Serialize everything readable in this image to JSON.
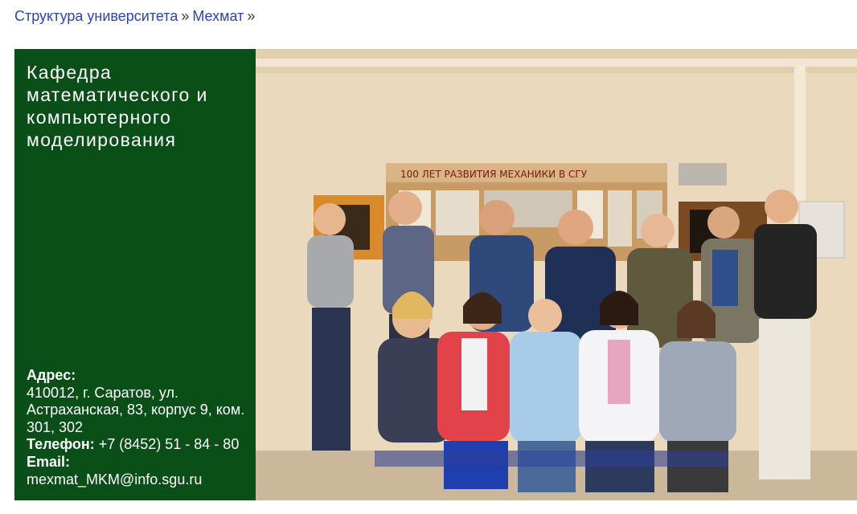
{
  "breadcrumb": {
    "items": [
      "Структура университета",
      "Мехмат"
    ],
    "separator": "»"
  },
  "department": {
    "title": "Кафедра математического и компьютерного моделирования"
  },
  "contacts": {
    "address_label": "Адрес:",
    "address_value": "410012, г. Саратов, ул. Астраханская, 83, корпус 9, ком. 301, 302",
    "phone_label": "Телефон:",
    "phone_value": "+7 (8452) 51 - 84 - 80",
    "email_label": "Email:",
    "email_value": "mexmat_MKM@info.sgu.ru"
  },
  "photo": {
    "banner_text": "100 ЛЕТ РАЗВИТИЯ МЕХАНИКИ В СГУ"
  },
  "colors": {
    "panel_bg": "#0a4e18",
    "link": "#2a45b8"
  }
}
